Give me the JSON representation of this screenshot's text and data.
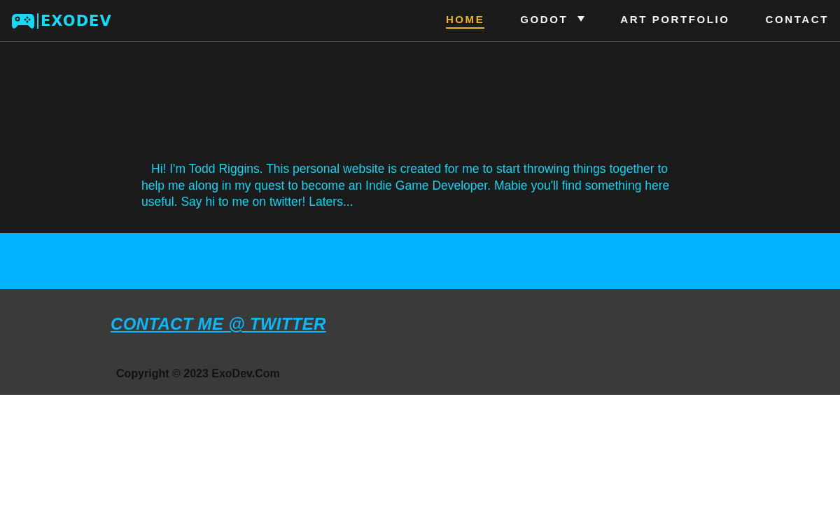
{
  "header": {
    "logo_text": "EXODEV",
    "nav": [
      {
        "label": "HOME",
        "kind": "link",
        "selected": true
      },
      {
        "label": "GODOT",
        "kind": "dropdown",
        "selected": false
      },
      {
        "label": "ART PORTFOLIO",
        "kind": "link",
        "selected": false
      },
      {
        "label": "CONTACT",
        "kind": "link",
        "selected": false
      }
    ]
  },
  "hero": {
    "intro": "Hi! I'm Todd Riggins. This personal website is created for me to start throwing things together to help me along in my quest to become an Indie Game Developer. Mabie you'll find something here useful. Say hi to me on twitter! Laters..."
  },
  "footer": {
    "twitter_link": "CONTACT ME @ TWITTER",
    "copyright": "Copyright © 2023 ExoDev.Com"
  }
}
